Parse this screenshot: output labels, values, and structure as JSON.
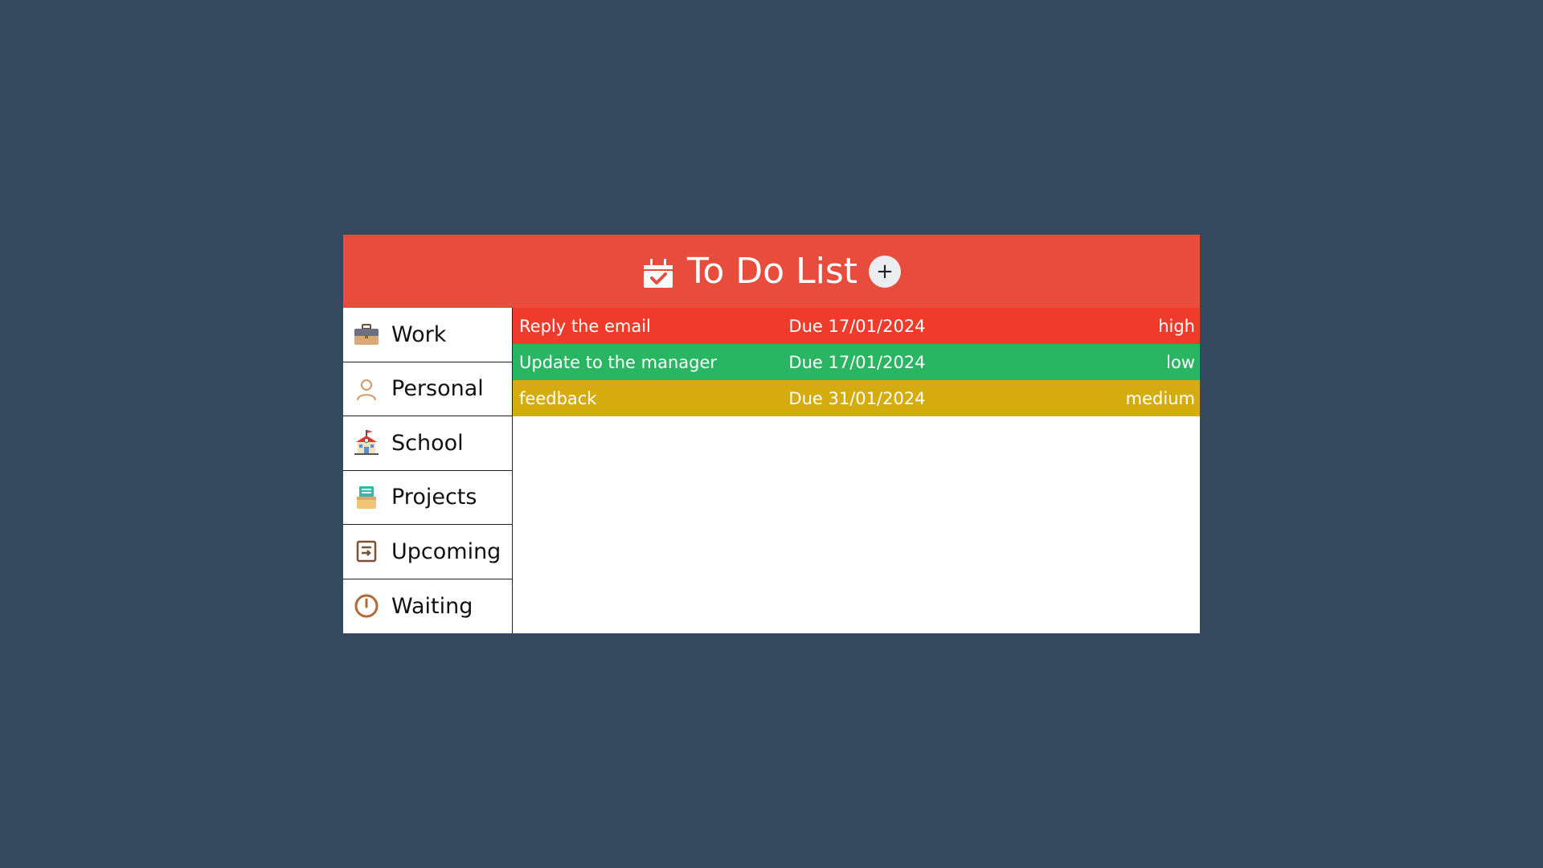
{
  "header": {
    "title": "To Do List",
    "icon": "calendar-check-icon",
    "add_label": "+"
  },
  "sidebar": {
    "items": [
      {
        "label": "Work",
        "icon": "briefcase-icon"
      },
      {
        "label": "Personal",
        "icon": "person-icon"
      },
      {
        "label": "School",
        "icon": "school-icon"
      },
      {
        "label": "Projects",
        "icon": "projects-icon"
      },
      {
        "label": "Upcoming",
        "icon": "upcoming-icon"
      },
      {
        "label": "Waiting",
        "icon": "clock-icon"
      }
    ]
  },
  "tasks": [
    {
      "name": "Reply the email",
      "due": "Due 17/01/2024",
      "priority": "high",
      "color": "#ee3b2b"
    },
    {
      "name": "Update to the manager",
      "due": "Due 17/01/2024",
      "priority": "low",
      "color": "#2ab562"
    },
    {
      "name": "feedback",
      "due": "Due 31/01/2024",
      "priority": "medium",
      "color": "#d4ac0d"
    }
  ],
  "colors": {
    "background": "#34495e",
    "header": "#e74c3c",
    "high": "#ee3b2b",
    "low": "#2ab562",
    "medium": "#d4ac0d"
  }
}
